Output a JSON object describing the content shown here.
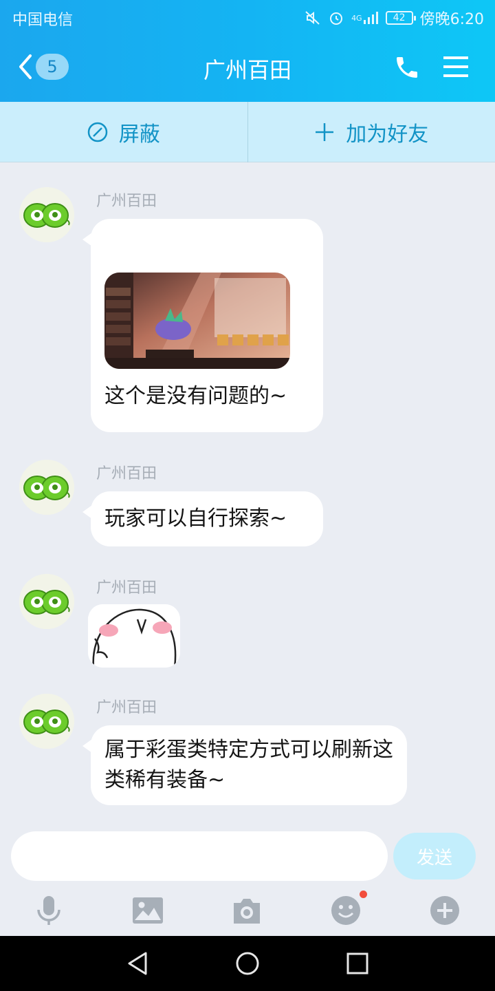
{
  "status_bar": {
    "carrier": "中国电信",
    "network": "4G",
    "battery": "42",
    "time": "傍晚6:20"
  },
  "header": {
    "unread_count": "5",
    "title": "广州百田"
  },
  "actions": {
    "block_label": "屏蔽",
    "add_friend_label": "加为好友"
  },
  "messages": [
    {
      "sender": "广州百田",
      "text": "这个是没有问题的~"
    },
    {
      "sender": "广州百田",
      "text": "玩家可以自行探索~"
    },
    {
      "sender": "广州百田"
    },
    {
      "sender": "广州百田",
      "text": "属于彩蛋类特定方式可以刷新这类稀有装备~"
    }
  ],
  "composer": {
    "input_value": "",
    "send_label": "发送"
  },
  "colors": {
    "header_start": "#1ba7ee",
    "header_end": "#0ec7f6",
    "accent": "#1293c6",
    "notification_dot": "#f24d3c"
  },
  "icons": [
    "back-icon",
    "phone-icon",
    "menu-icon",
    "block-icon",
    "plus-icon",
    "microphone-icon",
    "image-icon",
    "camera-icon",
    "emoji-icon",
    "add-icon",
    "nav-back-icon",
    "nav-home-icon",
    "nav-recents-icon"
  ]
}
